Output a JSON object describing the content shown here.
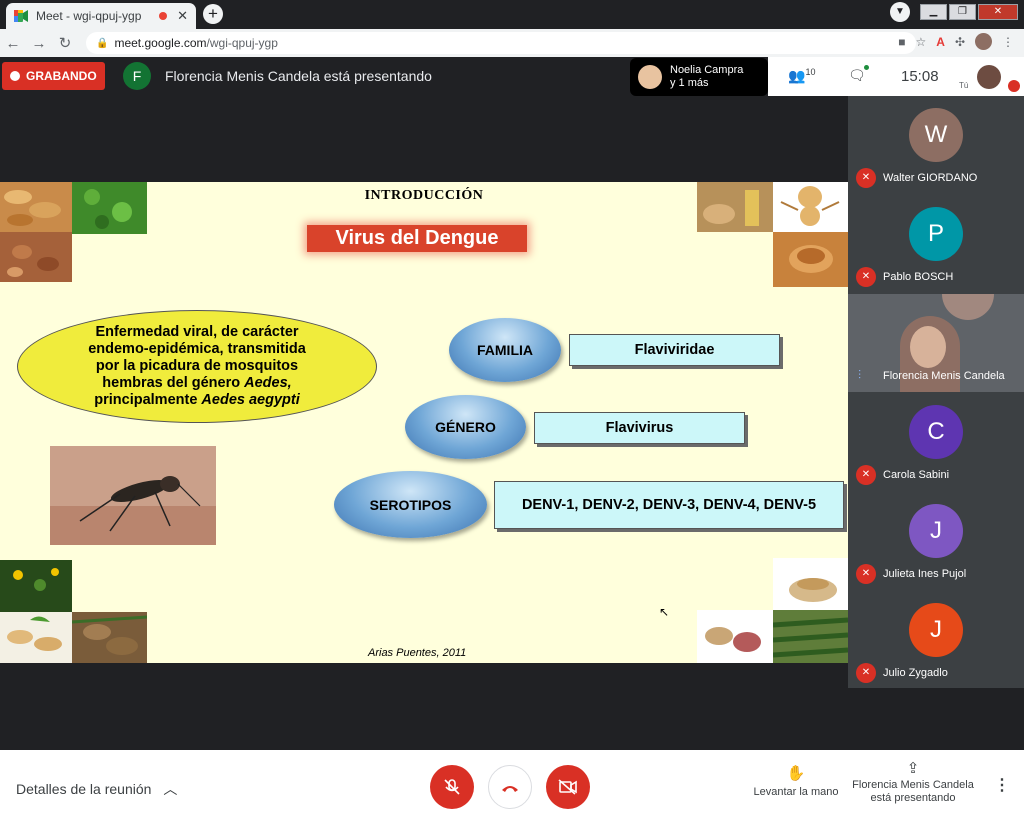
{
  "browser": {
    "tab_title": "Meet - wgi-qpuj-ygp",
    "tab_close": "✕",
    "new_tab": "+",
    "url_host": "meet.google.com",
    "url_path": "/wgi-qpuj-ygp"
  },
  "meet_header": {
    "recording_label": "GRABANDO",
    "presenter_initial": "F",
    "presenting_text": "Florencia Menis Candela está presentando",
    "speaker_chip_line1": "Noelia Campra",
    "speaker_chip_line2": "y 1 más",
    "people_count": "10",
    "clock": "15:08",
    "self_label": "Tú"
  },
  "slide": {
    "title": "INTRODUCCIÓN",
    "subtitle": "Virus del Dengue",
    "ellipse_line1": "Enfermedad viral, de carácter",
    "ellipse_line2": "endemo-epidémica, transmitida",
    "ellipse_line3": "por la picadura de mosquitos",
    "ellipse_line4a": "hembras del género ",
    "ellipse_line4b": "Aedes,",
    "ellipse_line5a": "principalmente ",
    "ellipse_line5b": "Aedes aegypti",
    "familia_label": "FAMILIA",
    "familia_value": "Flaviviridae",
    "genero_label": "GÉNERO",
    "genero_value": "Flavivirus",
    "serotipos_label": "SEROTIPOS",
    "serotipos_value": "DENV-1, DENV-2, DENV-3, DENV-4, DENV-5",
    "citation": "Arias Puentes, 2011"
  },
  "participants": [
    {
      "initial": "W",
      "name": "Walter GIORDANO",
      "color": "#8d6e63"
    },
    {
      "initial": "P",
      "name": "Pablo BOSCH",
      "color": "#0097a7"
    },
    {
      "initial": "",
      "name": "Florencia Menis Candela",
      "color": ""
    },
    {
      "initial": "C",
      "name": "Carola Sabini",
      "color": "#5e35b1"
    },
    {
      "initial": "J",
      "name": "Julieta Ines Pujol",
      "color": "#7e57c2"
    },
    {
      "initial": "J",
      "name": "Julio Zygadlo",
      "color": "#e64a19"
    }
  ],
  "bottom": {
    "details_label": "Detalles de la reunión",
    "raise_hand_label": "Levantar la mano",
    "present_line1": "Florencia Menis Candela",
    "present_line2": "está presentando"
  },
  "colors": {
    "recording": "#d93025",
    "slide_background": "#ffffdc",
    "ellipse_fill": "#f0ec3c",
    "value_box_fill": "#ccf7f9",
    "subtitle_fill": "#d9432b"
  }
}
